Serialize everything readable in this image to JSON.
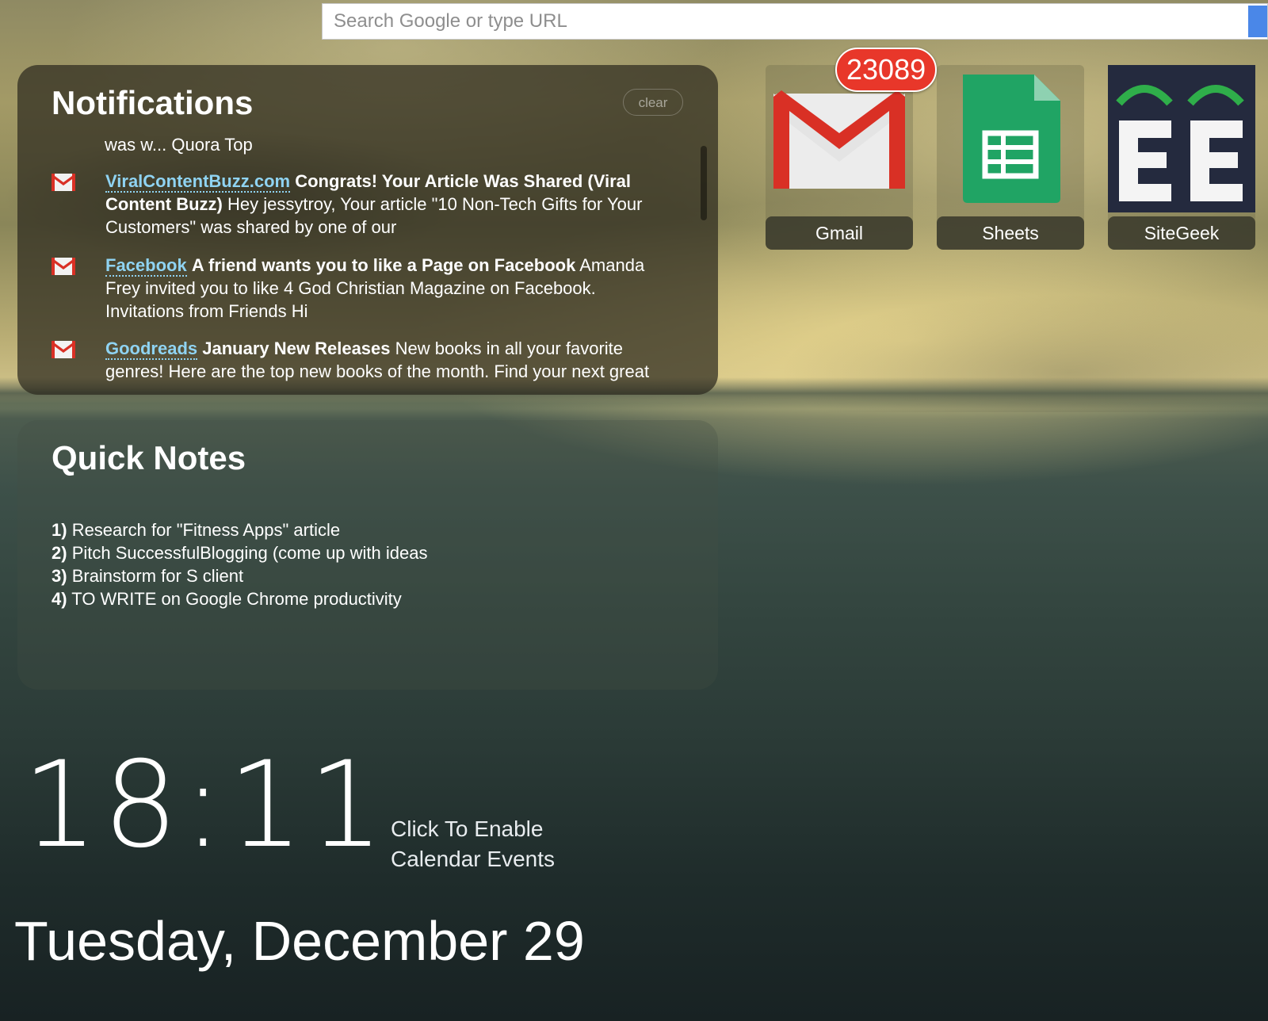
{
  "search": {
    "placeholder": "Search Google or type URL"
  },
  "notifications": {
    "title": "Notifications",
    "clear_label": "clear",
    "cut_line": "was w... Quora Top",
    "items": [
      {
        "source": "ViralContentBuzz.com",
        "subject": "Congrats! Your Article Was Shared (Viral Content Buzz)",
        "body": "Hey jessytroy, Your article \"10 Non-Tech Gifts for Your Customers\" was shared by one of our",
        "icon": "gmail-envelope-icon"
      },
      {
        "source": "Facebook",
        "subject": "A friend wants you to like a Page on Facebook",
        "body": "Amanda Frey invited you to like 4 God Christian Magazine on Facebook. Invitations from Friends Hi",
        "icon": "gmail-envelope-icon"
      },
      {
        "source": "Goodreads",
        "subject": "January New Releases",
        "body": "New books in all your favorite genres! Here are the top new books of the month. Find your next great",
        "icon": "gmail-envelope-icon"
      }
    ]
  },
  "quick_notes": {
    "title": "Quick Notes",
    "items": [
      {
        "num": "1)",
        "text": "Research for \"Fitness Apps\" article"
      },
      {
        "num": "2)",
        "text": "Pitch SuccessfulBlogging (come up with ideas"
      },
      {
        "num": "3)",
        "text": "Brainstorm for S client"
      },
      {
        "num": "4)",
        "text": "TO WRITE on Google Chrome productivity"
      }
    ]
  },
  "apps": [
    {
      "label": "Gmail",
      "icon": "gmail-icon",
      "badge": "23089"
    },
    {
      "label": "Sheets",
      "icon": "sheets-icon"
    },
    {
      "label": "SiteGeek",
      "icon": "sitegeek-icon"
    }
  ],
  "clock": {
    "time": "18:11",
    "calendar_prompt_line1": "Click To Enable",
    "calendar_prompt_line2": "Calendar Events",
    "date": "Tuesday, December 29"
  },
  "colors": {
    "link": "#8fd3f2",
    "badge": "#e8372a",
    "search_button": "#4a87e8",
    "sheets_green": "#20a464",
    "gmail_red": "#d93025"
  }
}
